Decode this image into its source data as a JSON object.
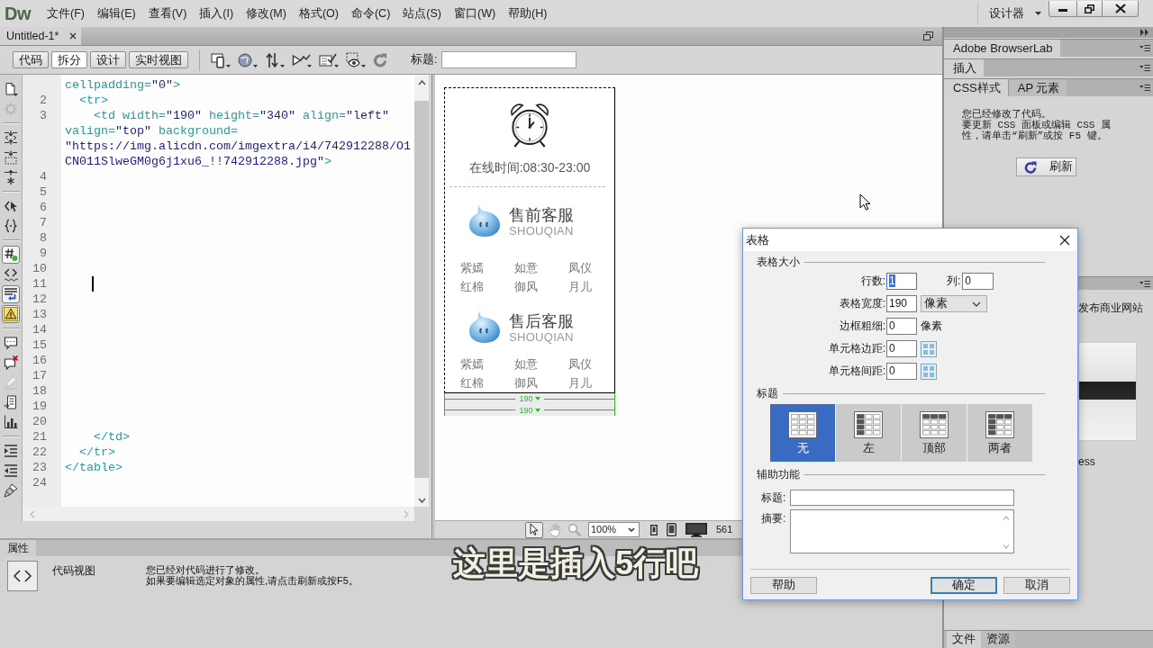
{
  "menu_bar": {
    "logo": "Dw",
    "menus": [
      "文件(F)",
      "编辑(E)",
      "查看(V)",
      "插入(I)",
      "修改(M)",
      "格式(O)",
      "命令(C)",
      "站点(S)",
      "窗口(W)",
      "帮助(H)"
    ],
    "workspace": "设计器"
  },
  "document_tabs": [
    {
      "label": "Untitled-1*",
      "selected": true
    }
  ],
  "view_buttons": [
    {
      "label": "代码",
      "selected": false
    },
    {
      "label": "拆分",
      "selected": true
    },
    {
      "label": "设计",
      "selected": false
    },
    {
      "label": "实时视图",
      "selected": false
    }
  ],
  "title_field": {
    "label": "标题:"
  },
  "coding_toolbar": [
    [
      {
        "kind": "document",
        "on": false,
        "disabled": false
      },
      {
        "kind": "gear",
        "on": false,
        "disabled": true
      }
    ],
    [
      {
        "kind": "collapse",
        "on": false,
        "disabled": false
      },
      {
        "kind": "collapse_selection",
        "on": false,
        "disabled": false
      },
      {
        "kind": "expand",
        "on": false,
        "disabled": false
      }
    ],
    [
      {
        "kind": "tag",
        "on": false,
        "disabled": false
      },
      {
        "kind": "braces",
        "on": false,
        "disabled": false
      }
    ],
    [
      {
        "kind": "hash",
        "on": true,
        "disabled": false
      },
      {
        "kind": "code",
        "on": false,
        "disabled": false
      },
      {
        "kind": "word_wrap",
        "on": true,
        "disabled": false
      },
      {
        "kind": "warning",
        "on": true,
        "disabled": false
      }
    ],
    [
      {
        "kind": "comment",
        "on": false,
        "disabled": false
      },
      {
        "kind": "comment_remove",
        "on": false,
        "disabled": false
      },
      {
        "kind": "pencil",
        "on": false,
        "disabled": true
      },
      {
        "kind": "snippet",
        "on": false,
        "disabled": false
      },
      {
        "kind": "chart",
        "on": false,
        "disabled": false
      }
    ],
    [
      {
        "kind": "indent",
        "on": false,
        "disabled": false
      },
      {
        "kind": "outdent",
        "on": false,
        "disabled": false
      },
      {
        "kind": "brush",
        "on": false,
        "disabled": false
      }
    ]
  ],
  "code_lines": [
    {
      "tokens": [
        {
          "kind": "markup",
          "text": "cellpadding="
        },
        {
          "kind": "string",
          "text": "\"0\""
        },
        {
          "kind": "markup",
          "text": ">"
        }
      ],
      "caret": false
    },
    {
      "number": "2",
      "tokens": [
        {
          "kind": "markup",
          "text": "  <tr>"
        }
      ],
      "caret": false
    },
    {
      "number": "3",
      "tokens": [
        {
          "kind": "markup",
          "text": "    <td width="
        },
        {
          "kind": "string",
          "text": "\"190\""
        },
        {
          "kind": "markup",
          "text": " height="
        },
        {
          "kind": "string",
          "text": "\"340\""
        },
        {
          "kind": "markup",
          "text": " align="
        },
        {
          "kind": "string",
          "text": "\"left\""
        }
      ],
      "caret": false
    },
    {
      "tokens": [
        {
          "kind": "markup",
          "text": "valign="
        },
        {
          "kind": "string",
          "text": "\"top\""
        },
        {
          "kind": "markup",
          "text": " background="
        }
      ],
      "caret": false
    },
    {
      "tokens": [
        {
          "kind": "string",
          "text": "\"https://img.alicdn.com/imgextra/i4/742912288/O1"
        }
      ],
      "caret": false
    },
    {
      "tokens": [
        {
          "kind": "string",
          "text": "CN011SlweGM0g6j1xu6_!!742912288.jpg\""
        },
        {
          "kind": "markup",
          "text": ">"
        }
      ],
      "caret": false
    },
    {
      "number": "4",
      "caret": false
    },
    {
      "number": "5",
      "caret": false
    },
    {
      "number": "6",
      "caret": false
    },
    {
      "number": "7",
      "caret": false
    },
    {
      "number": "8",
      "caret": false
    },
    {
      "number": "9",
      "caret": false
    },
    {
      "number": "10",
      "caret": false
    },
    {
      "number": "11",
      "caret": true
    },
    {
      "number": "12",
      "caret": false
    },
    {
      "number": "13",
      "caret": false
    },
    {
      "number": "14",
      "caret": false
    },
    {
      "number": "15",
      "caret": false
    },
    {
      "number": "16",
      "caret": false
    },
    {
      "number": "17",
      "caret": false
    },
    {
      "number": "18",
      "caret": false
    },
    {
      "number": "19",
      "caret": false
    },
    {
      "number": "20",
      "caret": false
    },
    {
      "number": "21",
      "tokens": [
        {
          "kind": "markup",
          "text": "    </td>"
        }
      ],
      "caret": false
    },
    {
      "number": "22",
      "tokens": [
        {
          "kind": "markup",
          "text": "  </tr>"
        }
      ],
      "caret": false
    },
    {
      "number": "23",
      "tokens": [
        {
          "kind": "markup",
          "text": "</table>"
        }
      ],
      "caret": false
    },
    {
      "number": "24",
      "caret": false
    }
  ],
  "design_view": {
    "online_hours": "在线时间:08:30-23:00",
    "service_groups": [
      {
        "title": "售前客服",
        "subtitle": "SHOUQIAN",
        "names": [
          "紫嫣",
          "如意",
          "凤仪",
          "红棉",
          "御风",
          "月儿"
        ]
      },
      {
        "title": "售后客服",
        "subtitle": "SHOUQIAN",
        "names": [
          "紫嫣",
          "如意",
          "凤仪",
          "红棉",
          "御风",
          "月儿"
        ]
      }
    ],
    "width_markers": [
      "190",
      "190"
    ]
  },
  "design_status": {
    "tools": [
      {
        "kind": "pointer",
        "selected": true
      },
      {
        "kind": "hand",
        "selected": false
      },
      {
        "kind": "zoom",
        "selected": false
      }
    ],
    "zoom": "100%",
    "window_size": "561"
  },
  "properties_panel": {
    "title": "属性",
    "mode": "代码视图",
    "message": [
      "您已经对代码进行了修改。",
      "如果要编辑选定对象的属性,请点击刷新或按F5。"
    ]
  },
  "video_subtitle": "这里是插入5行吧",
  "right_panel": {
    "collapsed_panels": [
      "Adobe BrowserLab",
      "插入"
    ],
    "css_tabs": [
      {
        "label": "CSS样式",
        "selected": true
      },
      {
        "label": "AP 元素",
        "selected": false
      }
    ],
    "css_message": [
      "您已经修改了代码。",
      "要更新 CSS 面板或编辑 CSS 属",
      "性，请单击“刷新”或按 F5 键。"
    ],
    "refresh_button": "刷新",
    "lower_panel": {
      "heading": "发布商业网站",
      "caption": "ess"
    },
    "bottom_tabs": [
      {
        "label": "文件",
        "selected": true
      },
      {
        "label": "资源",
        "selected": false
      }
    ]
  },
  "dialog": {
    "title": "表格",
    "size_title": "表格大小",
    "size_rows": [
      {
        "kind": "pair",
        "label": "行数:",
        "value": "1",
        "focused": true,
        "second_label": "列:",
        "second_value": "0"
      },
      {
        "kind": "select",
        "label": "表格宽度:",
        "value": "190",
        "focused": false,
        "unit": "像素"
      },
      {
        "kind": "unit",
        "label": "边框粗细:",
        "value": "0",
        "focused": false,
        "unit": "像素"
      },
      {
        "kind": "grid",
        "label": "单元格边距:",
        "value": "0",
        "focused": false
      },
      {
        "kind": "grid",
        "label": "单元格间距:",
        "value": "0",
        "focused": false
      }
    ],
    "header_title": "标题",
    "header_options": [
      {
        "kind": "none",
        "label": "无",
        "selected": true
      },
      {
        "kind": "left",
        "label": "左",
        "selected": false
      },
      {
        "kind": "top",
        "label": "顶部",
        "selected": false
      },
      {
        "kind": "both",
        "label": "两者",
        "selected": false
      }
    ],
    "accessibility_title": "辅助功能",
    "caption_label": "标题:",
    "summary_label": "摘要:",
    "buttons": [
      {
        "label": "帮助",
        "default": false
      },
      {
        "label": "确定",
        "default": true
      },
      {
        "label": "取消",
        "default": false
      }
    ]
  }
}
